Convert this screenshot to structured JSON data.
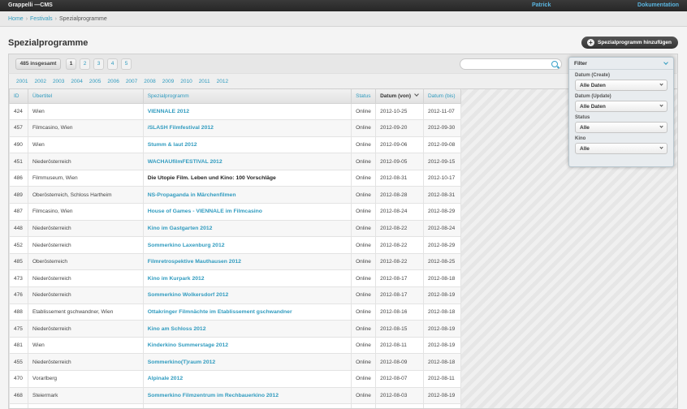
{
  "app": {
    "title": "Grappelli —CMS",
    "user": "Patrick",
    "docs": "Dokumentation"
  },
  "breadcrumbs": [
    "Home",
    "Festivals",
    "Spezialprogramme"
  ],
  "page_title": "Spezialprogramme",
  "add_button": "Spezialprogramm hinzufügen",
  "total_label": "485 insgesamt",
  "pages": [
    "1",
    "2",
    "3",
    "4",
    "5"
  ],
  "years": [
    "2001",
    "2002",
    "2003",
    "2004",
    "2005",
    "2006",
    "2007",
    "2008",
    "2009",
    "2010",
    "2011",
    "2012"
  ],
  "columns": {
    "id": "ID",
    "ort": "Übertitel",
    "name": "Spezialprogramm",
    "status": "Status",
    "von": "Datum (von)",
    "bis": "Datum (bis)"
  },
  "rows": [
    {
      "id": "424",
      "ort": "Wien",
      "name": "VIENNALE 2012",
      "status": "Online",
      "von": "2012-10-25",
      "bis": "2012-11-07"
    },
    {
      "id": "457",
      "ort": "Filmcasino, Wien",
      "name": "/SLASH Filmfestival 2012",
      "status": "Online",
      "von": "2012-09-20",
      "bis": "2012-09-30"
    },
    {
      "id": "490",
      "ort": "Wien",
      "name": "Stumm & laut 2012",
      "status": "Online",
      "von": "2012-09-06",
      "bis": "2012-09-08"
    },
    {
      "id": "451",
      "ort": "Niederösterreich",
      "name": "WACHAUfilmFESTIVAL 2012",
      "status": "Online",
      "von": "2012-09-05",
      "bis": "2012-09-15"
    },
    {
      "id": "486",
      "ort": "Filmmuseum, Wien",
      "name": "Die Utopie Film. Leben und Kino: 100 Vorschläge",
      "status": "Online",
      "von": "2012-08-31",
      "bis": "2012-10-17"
    },
    {
      "id": "489",
      "ort": "Oberösterreich, Schloss Hartheim",
      "name": "NS-Propaganda in Märchenfilmen",
      "status": "Online",
      "von": "2012-08-28",
      "bis": "2012-08-31"
    },
    {
      "id": "487",
      "ort": "Filmcasino, Wien",
      "name": "House of Games - VIENNALE im Filmcasino",
      "status": "Online",
      "von": "2012-08-24",
      "bis": "2012-08-29"
    },
    {
      "id": "448",
      "ort": "Niederösterreich",
      "name": "Kino im Gastgarten 2012",
      "status": "Online",
      "von": "2012-08-22",
      "bis": "2012-08-24"
    },
    {
      "id": "452",
      "ort": "Niederösterreich",
      "name": "Sommerkino Laxenburg 2012",
      "status": "Online",
      "von": "2012-08-22",
      "bis": "2012-08-29"
    },
    {
      "id": "485",
      "ort": "Oberösterreich",
      "name": "Filmretrospektive Mauthausen 2012",
      "status": "Online",
      "von": "2012-08-22",
      "bis": "2012-08-25"
    },
    {
      "id": "473",
      "ort": "Niederösterreich",
      "name": "Kino im Kurpark 2012",
      "status": "Online",
      "von": "2012-08-17",
      "bis": "2012-08-18"
    },
    {
      "id": "476",
      "ort": "Niederösterreich",
      "name": "Sommerkino Wolkersdorf 2012",
      "status": "Online",
      "von": "2012-08-17",
      "bis": "2012-08-19"
    },
    {
      "id": "488",
      "ort": "Etablissement gschwandner, Wien",
      "name": "Ottakringer Filmnächte im Etablissement gschwandner",
      "status": "Online",
      "von": "2012-08-16",
      "bis": "2012-08-18"
    },
    {
      "id": "475",
      "ort": "Niederösterreich",
      "name": "Kino am Schloss 2012",
      "status": "Online",
      "von": "2012-08-15",
      "bis": "2012-08-19"
    },
    {
      "id": "481",
      "ort": "Wien",
      "name": "Kinderkino Summerstage 2012",
      "status": "Online",
      "von": "2012-08-11",
      "bis": "2012-08-19"
    },
    {
      "id": "455",
      "ort": "Niederösterreich",
      "name": "Sommerkino(T)raum 2012",
      "status": "Online",
      "von": "2012-08-09",
      "bis": "2012-08-18"
    },
    {
      "id": "470",
      "ort": "Vorarlberg",
      "name": "Alpinale 2012",
      "status": "Online",
      "von": "2012-08-07",
      "bis": "2012-08-11"
    },
    {
      "id": "468",
      "ort": "Steiermark",
      "name": "Sommerkino Filmzentrum im Rechbauerkino 2012",
      "status": "Online",
      "von": "2012-08-03",
      "bis": "2012-08-19"
    },
    {
      "id": "",
      "ort": "",
      "name": "",
      "status": "",
      "von": "",
      "bis": ""
    }
  ],
  "filter": {
    "title": "Filter",
    "groups": [
      {
        "label": "Datum (Create)",
        "value": "Alle Daten"
      },
      {
        "label": "Datum (Update)",
        "value": "Alle Daten"
      },
      {
        "label": "Status",
        "value": "Alle"
      },
      {
        "label": "Kino",
        "value": "Alle"
      }
    ]
  }
}
